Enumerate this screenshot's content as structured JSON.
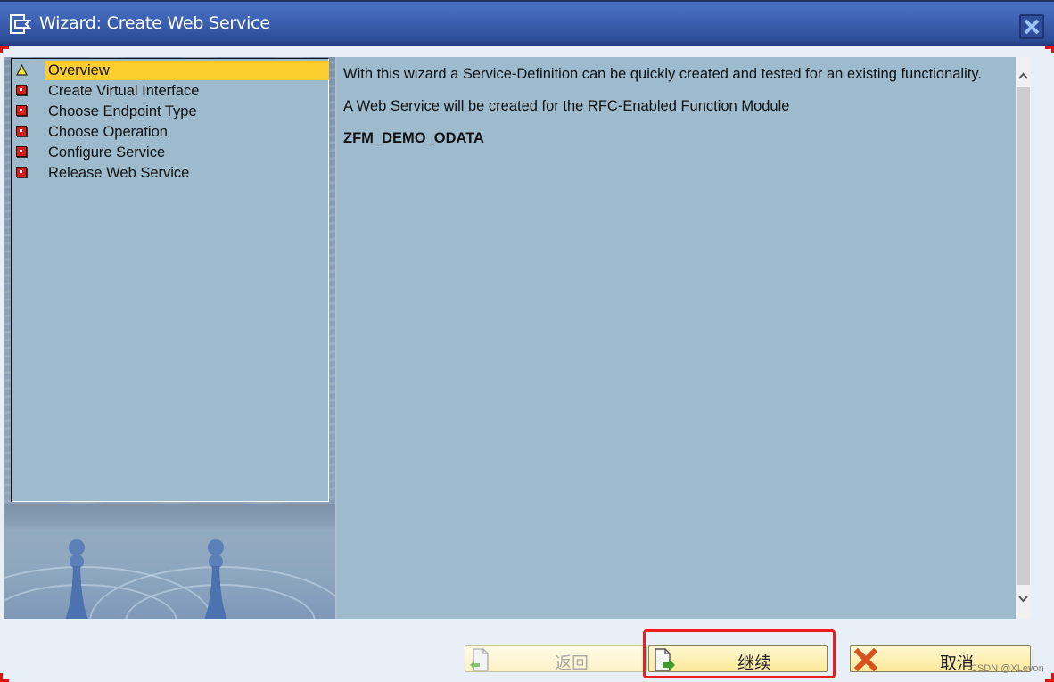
{
  "window": {
    "title": "Wizard: Create Web Service",
    "title_icon": "wizard-icon",
    "close_icon": "close-icon"
  },
  "steps": [
    {
      "label": "Overview",
      "status": "current",
      "icon": "warning-triangle-icon"
    },
    {
      "label": "Create Virtual Interface",
      "status": "pending",
      "icon": "red-square-icon"
    },
    {
      "label": "Choose Endpoint Type",
      "status": "pending",
      "icon": "red-square-icon"
    },
    {
      "label": "Choose Operation",
      "status": "pending",
      "icon": "red-square-icon"
    },
    {
      "label": "Configure Service",
      "status": "pending",
      "icon": "red-square-icon"
    },
    {
      "label": "Release Web Service",
      "status": "pending",
      "icon": "red-square-icon"
    }
  ],
  "content": {
    "intro": "With this wizard a Service-Definition can be quickly created and tested for an existing functionality.",
    "info": "A Web Service will be created for the RFC-Enabled Function Module",
    "function_module": "ZFM_DEMO_ODATA"
  },
  "buttons": {
    "back": {
      "label": "返回",
      "enabled": false,
      "icon": "back-arrow-icon"
    },
    "continue": {
      "label": "继续",
      "enabled": true,
      "icon": "forward-arrow-icon"
    },
    "cancel": {
      "label": "取消",
      "enabled": true,
      "icon": "cancel-x-icon"
    }
  },
  "watermark": "CSDN @XLevon",
  "colors": {
    "titlebar": "#3e63b4",
    "active_step": "#fccd2e",
    "panel": "#9dbbcd",
    "highlight": "#ee1c1c",
    "button": "#fde99a"
  }
}
